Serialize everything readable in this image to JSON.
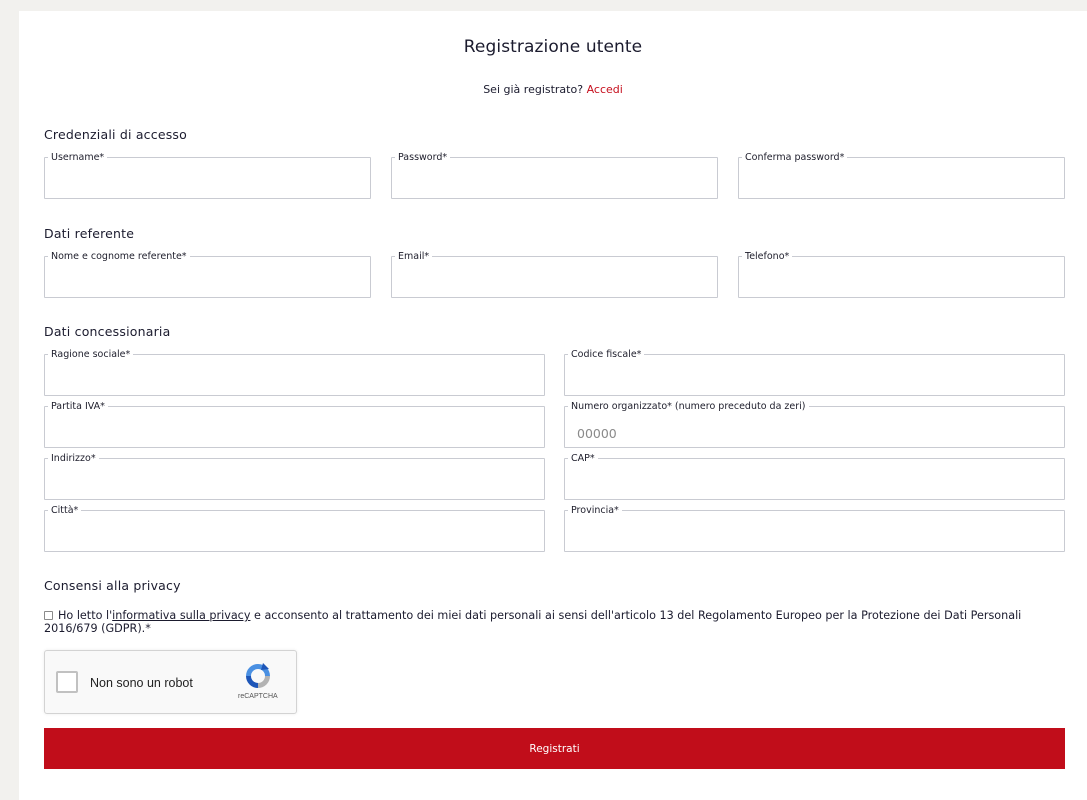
{
  "header": {
    "title": "Registrazione utente",
    "login_prompt": "Sei già registrato?",
    "login_link": "Accedi"
  },
  "sections": {
    "credentials": "Credenziali di accesso",
    "referent": "Dati referente",
    "dealer": "Dati concessionaria",
    "privacy": "Consensi alla privacy"
  },
  "fields": {
    "username": {
      "label": "Username*",
      "value": ""
    },
    "password": {
      "label": "Password*",
      "value": ""
    },
    "confirm_password": {
      "label": "Conferma password*",
      "value": ""
    },
    "full_name": {
      "label": "Nome e cognome referente*",
      "value": ""
    },
    "email": {
      "label": "Email*",
      "value": ""
    },
    "phone": {
      "label": "Telefono*",
      "value": ""
    },
    "company_name": {
      "label": "Ragione sociale*",
      "value": ""
    },
    "tax_code": {
      "label": "Codice fiscale*",
      "value": ""
    },
    "vat_number": {
      "label": "Partita IVA*",
      "value": ""
    },
    "organizer_number": {
      "label": "Numero organizzato* (numero preceduto da zeri)",
      "placeholder": "00000",
      "value": ""
    },
    "address": {
      "label": "Indirizzo*",
      "value": ""
    },
    "zip": {
      "label": "CAP*",
      "value": ""
    },
    "city": {
      "label": "Città*",
      "value": ""
    },
    "province": {
      "label": "Provincia*",
      "value": ""
    }
  },
  "privacy": {
    "checked": false,
    "text_before": "Ho letto l'",
    "link": "informativa sulla privacy",
    "text_after": " e acconsento al trattamento dei miei dati personali ai sensi dell'articolo 13 del Regolamento Europeo per la Protezione dei Dati Personali 2016/679 (GDPR).*"
  },
  "recaptcha": {
    "label": "Non sono un robot",
    "brand": "reCAPTCHA",
    "icon": "recaptcha-logo-icon"
  },
  "submit": {
    "label": "Registrati"
  },
  "colors": {
    "accent": "#c10d1a",
    "link": "#c60f1d",
    "page_bg": "#f2f1ee",
    "border": "#c9cbd2"
  }
}
